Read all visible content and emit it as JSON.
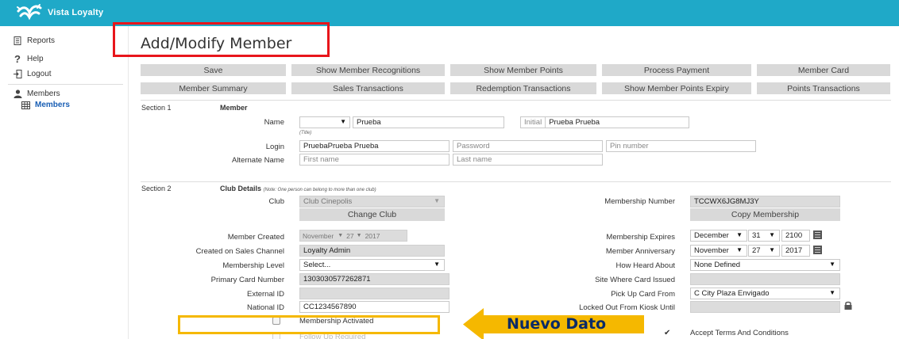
{
  "app": {
    "brand": "Vista Loyalty"
  },
  "sidebar": {
    "items": [
      {
        "label": "Reports",
        "icon": "document-icon"
      },
      {
        "label": "Help",
        "icon": "question-icon"
      },
      {
        "label": "Logout",
        "icon": "logout-icon"
      },
      {
        "label": "Members",
        "icon": "user-icon"
      }
    ],
    "sub_items": [
      {
        "label": "Members",
        "icon": "table-icon"
      }
    ]
  },
  "page": {
    "title": "Add/Modify Member"
  },
  "toolbar": {
    "row1": [
      "Save",
      "Show Member Recognitions",
      "Show Member Points",
      "Process Payment",
      "Member Card"
    ],
    "row2": [
      "Member Summary",
      "Sales Transactions",
      "Redemption Transactions",
      "Show Member Points Expiry",
      "Points Transactions"
    ]
  },
  "section1": {
    "label": "Section 1",
    "title": "Member",
    "name_label": "Name",
    "title_value": "",
    "title_hint": "(Title)",
    "first_name": "Prueba",
    "initial_label": "Initial",
    "initial_value": "Prueba Prueba",
    "login_label": "Login",
    "login_value": "PruebaPrueba Prueba",
    "password_placeholder": "Password",
    "pin_placeholder": "Pin number",
    "alt_name_label": "Alternate Name",
    "alt_first_placeholder": "First name",
    "alt_last_placeholder": "Last name"
  },
  "section2": {
    "label": "Section 2",
    "title": "Club Details",
    "note": "(Note: One person can belong to more than one club)",
    "club_label": "Club",
    "club_value": "Club Cinepolis",
    "change_club": "Change Club",
    "membership_number_label": "Membership Number",
    "membership_number": "TCCWX6JG8MJ3Y",
    "copy_membership": "Copy Membership",
    "member_created_label": "Member Created",
    "member_created": {
      "month": "November",
      "day": "27",
      "year": "2017"
    },
    "membership_expires_label": "Membership Expires",
    "membership_expires": {
      "month": "December",
      "day": "31",
      "year": "2100"
    },
    "created_channel_label": "Created on Sales Channel",
    "created_channel": "Loyalty Admin",
    "anniversary_label": "Member Anniversary",
    "anniversary": {
      "month": "November",
      "day": "27",
      "year": "2017"
    },
    "level_label": "Membership Level",
    "level_value": "Select...",
    "heard_label": "How Heard About",
    "heard_value": "None Defined",
    "primary_card_label": "Primary Card Number",
    "primary_card": "1303030577262871",
    "site_issued_label": "Site Where Card Issued",
    "site_issued": "",
    "external_id_label": "External ID",
    "external_id": "",
    "pickup_label": "Pick Up Card From",
    "pickup_value": "C City Plaza Envigado",
    "national_id_label": "National ID",
    "national_id": "CC1234567890",
    "locked_label": "Locked Out From Kiosk Until",
    "locked_value": "",
    "activated_label": "Membership Activated",
    "accept_terms_label": "Accept Terms And Conditions",
    "partial_label": "Follow Up Required"
  },
  "annotation": {
    "text": "Nuevo Dato"
  },
  "colors": {
    "topbar": "#1fa9c8",
    "button": "#d9d9d9",
    "highlight_red": "#e8151b",
    "highlight_yellow": "#f5b800",
    "annotation_text": "#0a2a66"
  }
}
